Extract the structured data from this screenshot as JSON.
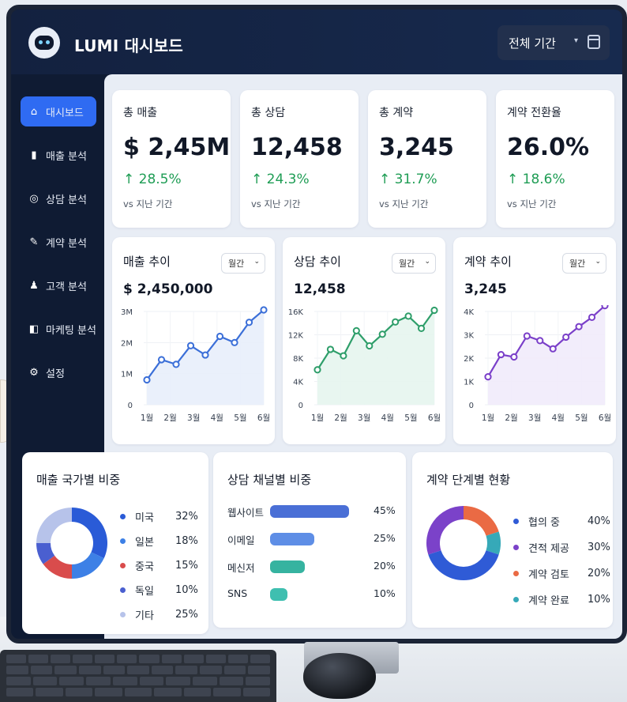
{
  "app": {
    "title": "LUMI 대시보드",
    "period": "전체 기간"
  },
  "sidebar": {
    "items": [
      {
        "label": "대시보드",
        "icon": "home-icon",
        "active": true
      },
      {
        "label": "매출 분석",
        "icon": "bar-chart-icon"
      },
      {
        "label": "상담 분석",
        "icon": "headset-icon"
      },
      {
        "label": "계약 분석",
        "icon": "contract-icon"
      },
      {
        "label": "고객 분석",
        "icon": "users-icon"
      },
      {
        "label": "마케팅 분석",
        "icon": "megaphone-icon"
      },
      {
        "label": "설정",
        "icon": "gear-icon"
      }
    ]
  },
  "kpis": [
    {
      "label": "총 매출",
      "value": "$ 2,45M",
      "delta": "↑ 28.5%",
      "sub": "vs 지난 기간"
    },
    {
      "label": "총 상담",
      "value": "12,458",
      "delta": "↑ 24.3%",
      "sub": "vs 지난 기간"
    },
    {
      "label": "총 계약",
      "value": "3,245",
      "delta": "↑ 31.7%",
      "sub": "vs 지난 기간"
    },
    {
      "label": "계약 전환율",
      "value": "26.0%",
      "delta": "↑ 18.6%",
      "sub": "vs 지난 기간"
    }
  ],
  "charts": [
    {
      "title": "매출 추이",
      "select": "월간",
      "value": "$ 2,450,000",
      "color": "#3b6fd8",
      "fill": "#e8eefb",
      "yticks": [
        "3M",
        "2M",
        "1M",
        "0"
      ],
      "ymax": 3000000,
      "xticks": [
        "1월",
        "2월",
        "3월",
        "4월",
        "5월",
        "6월"
      ],
      "points": [
        800000,
        1450000,
        1300000,
        1900000,
        1600000,
        2200000,
        2000000,
        2650000,
        3050000
      ]
    },
    {
      "title": "상담 추이",
      "select": "월간",
      "value": "12,458",
      "color": "#2e9e6a",
      "fill": "#e6f5ee",
      "yticks": [
        "16K",
        "12K",
        "8K",
        "4K",
        "0"
      ],
      "ymax": 16000,
      "xticks": [
        "1월",
        "2월",
        "3월",
        "4월",
        "5월",
        "6월"
      ],
      "points": [
        6000,
        9500,
        8400,
        12700,
        10100,
        12100,
        14200,
        15200,
        13100,
        16200
      ]
    },
    {
      "title": "계약 추이",
      "select": "월간",
      "value": "3,245",
      "color": "#7a3fc9",
      "fill": "#f1ebfb",
      "yticks": [
        "4K",
        "3K",
        "2K",
        "1K",
        "0"
      ],
      "ymax": 4000,
      "xticks": [
        "1월",
        "2월",
        "3월",
        "4월",
        "5월",
        "6월"
      ],
      "points": [
        1200,
        2150,
        2050,
        2950,
        2750,
        2400,
        2900,
        3350,
        3750,
        4250
      ]
    }
  ],
  "countries": {
    "title": "매출 국가별 비중",
    "items": [
      {
        "label": "미국",
        "pct": "32%",
        "value": 32,
        "color": "#2a5bd7"
      },
      {
        "label": "일본",
        "pct": "18%",
        "value": 18,
        "color": "#3d80e6"
      },
      {
        "label": "중국",
        "pct": "15%",
        "value": 15,
        "color": "#d94c4c"
      },
      {
        "label": "독일",
        "pct": "10%",
        "value": 10,
        "color": "#4a5fd0"
      },
      {
        "label": "기타",
        "pct": "25%",
        "value": 25,
        "color": "#b7c3ea"
      }
    ]
  },
  "channels": {
    "title": "상담 채널별 비중",
    "items": [
      {
        "label": "웹사이트",
        "pct": "45%",
        "value": 45,
        "color": "#4a6fd6"
      },
      {
        "label": "이메일",
        "pct": "25%",
        "value": 25,
        "color": "#5e8ee6"
      },
      {
        "label": "메신저",
        "pct": "20%",
        "value": 20,
        "color": "#36b3a0"
      },
      {
        "label": "SNS",
        "pct": "10%",
        "value": 10,
        "color": "#3fbfb0"
      }
    ]
  },
  "stages": {
    "title": "계약 단계별 현황",
    "items": [
      {
        "label": "협의 중",
        "pct": "40%",
        "value": 40,
        "color": "#2f5bd6"
      },
      {
        "label": "견적 제공",
        "pct": "30%",
        "value": 30,
        "color": "#7b42c9"
      },
      {
        "label": "계약 검토",
        "pct": "20%",
        "value": 20,
        "color": "#ea6a44"
      },
      {
        "label": "계약 완료",
        "pct": "10%",
        "value": 10,
        "color": "#36a9b8"
      }
    ]
  }
}
